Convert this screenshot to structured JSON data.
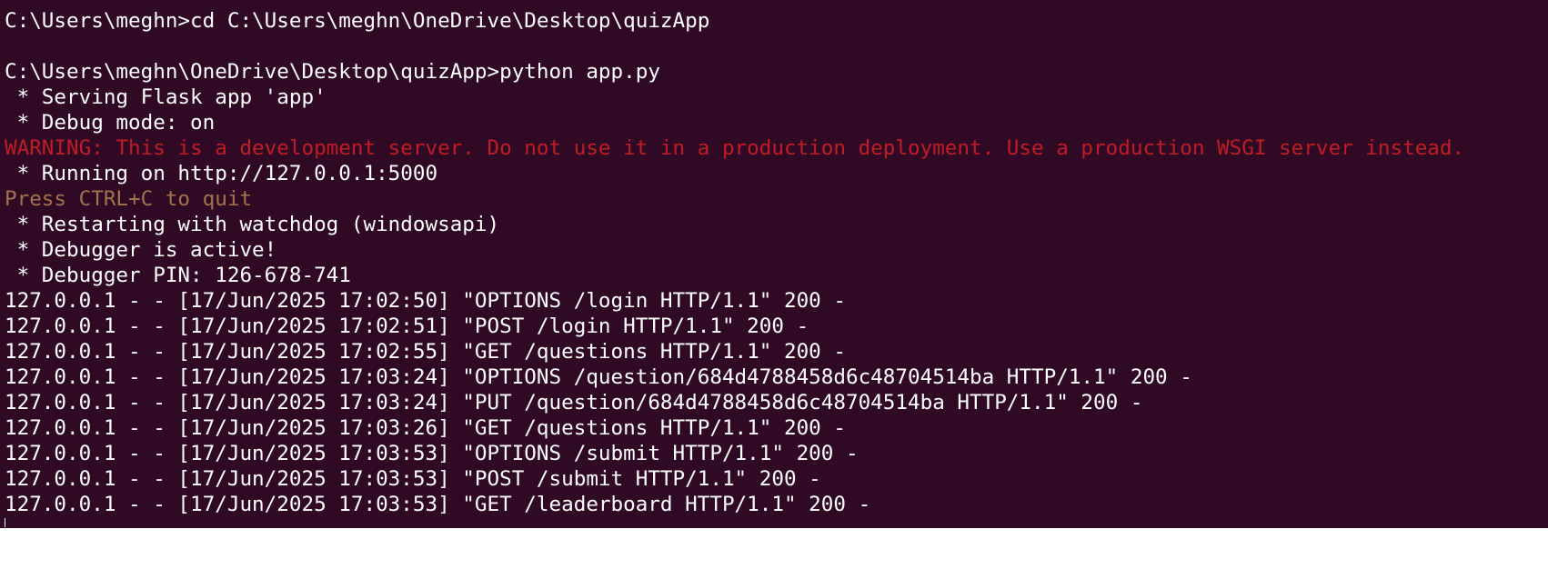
{
  "terminal": {
    "colors": {
      "background": "#300a24",
      "default_text": "#ffffff",
      "warning_text": "#c01c28",
      "hint_text": "#a2734c"
    },
    "lines": [
      {
        "text": "C:\\Users\\meghn>cd C:\\Users\\meghn\\OneDrive\\Desktop\\quizApp",
        "style": "normal"
      },
      {
        "text": "",
        "style": "blank"
      },
      {
        "text": "C:\\Users\\meghn\\OneDrive\\Desktop\\quizApp>python app.py",
        "style": "normal"
      },
      {
        "text": " * Serving Flask app 'app'",
        "style": "normal"
      },
      {
        "text": " * Debug mode: on",
        "style": "normal"
      },
      {
        "text": "WARNING: This is a development server. Do not use it in a production deployment. Use a production WSGI server instead.",
        "style": "warn"
      },
      {
        "text": " * Running on http://127.0.0.1:5000",
        "style": "normal"
      },
      {
        "text": "Press CTRL+C to quit",
        "style": "hint"
      },
      {
        "text": " * Restarting with watchdog (windowsapi)",
        "style": "normal"
      },
      {
        "text": " * Debugger is active!",
        "style": "normal"
      },
      {
        "text": " * Debugger PIN: 126-678-741",
        "style": "normal"
      },
      {
        "text": "127.0.0.1 - - [17/Jun/2025 17:02:50] \"OPTIONS /login HTTP/1.1\" 200 -",
        "style": "normal"
      },
      {
        "text": "127.0.0.1 - - [17/Jun/2025 17:02:51] \"POST /login HTTP/1.1\" 200 -",
        "style": "normal"
      },
      {
        "text": "127.0.0.1 - - [17/Jun/2025 17:02:55] \"GET /questions HTTP/1.1\" 200 -",
        "style": "normal"
      },
      {
        "text": "127.0.0.1 - - [17/Jun/2025 17:03:24] \"OPTIONS /question/684d4788458d6c48704514ba HTTP/1.1\" 200 -",
        "style": "normal"
      },
      {
        "text": "127.0.0.1 - - [17/Jun/2025 17:03:24] \"PUT /question/684d4788458d6c48704514ba HTTP/1.1\" 200 -",
        "style": "normal"
      },
      {
        "text": "127.0.0.1 - - [17/Jun/2025 17:03:26] \"GET /questions HTTP/1.1\" 200 -",
        "style": "normal"
      },
      {
        "text": "127.0.0.1 - - [17/Jun/2025 17:03:53] \"OPTIONS /submit HTTP/1.1\" 200 -",
        "style": "normal"
      },
      {
        "text": "127.0.0.1 - - [17/Jun/2025 17:03:53] \"POST /submit HTTP/1.1\" 200 -",
        "style": "normal"
      },
      {
        "text": "127.0.0.1 - - [17/Jun/2025 17:03:53] \"GET /leaderboard HTTP/1.1\" 200 -",
        "style": "normal"
      }
    ]
  }
}
